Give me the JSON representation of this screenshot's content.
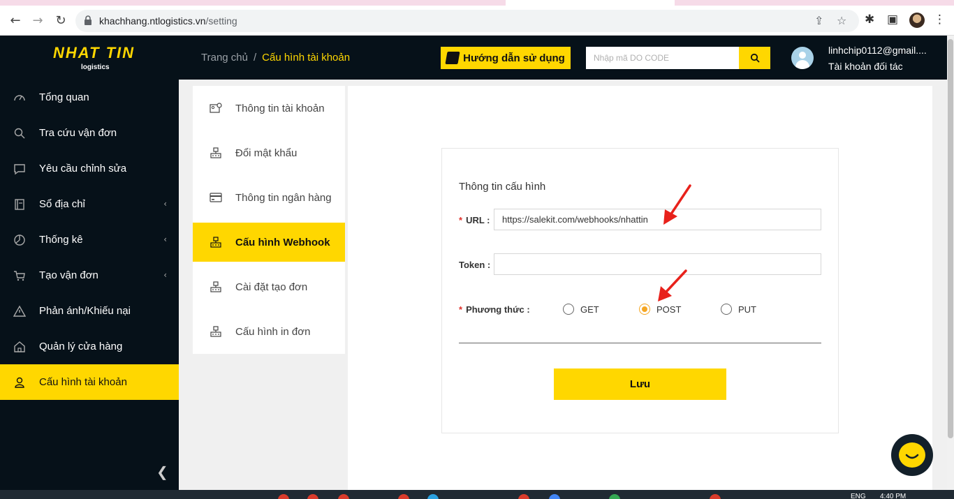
{
  "browser": {
    "url_host": "khachhang.ntlogistics.vn",
    "url_path": "/setting"
  },
  "header": {
    "logo_brand": "NHAT TIN",
    "logo_sub": "logistics",
    "breadcrumb_home": "Trang chủ",
    "breadcrumb_sep": "/",
    "breadcrumb_current": "Cấu hình tài khoản",
    "guide_label": "Hướng dẫn sử dụng",
    "search_placeholder": "Nhập mã DO CODE",
    "user_email": "linhchip0112@gmail....",
    "user_role": "Tài khoản đối tác"
  },
  "sidebar": {
    "items": [
      {
        "label": "Tổng quan"
      },
      {
        "label": "Tra cứu vận đơn"
      },
      {
        "label": "Yêu cầu chỉnh sửa"
      },
      {
        "label": "Sổ địa chỉ"
      },
      {
        "label": "Thống kê"
      },
      {
        "label": "Tạo vận đơn"
      },
      {
        "label": "Phản ánh/Khiếu nại"
      },
      {
        "label": "Quản lý cửa hàng"
      },
      {
        "label": "Cấu hình tài khoản"
      }
    ],
    "active_index": 8
  },
  "submenu": {
    "items": [
      {
        "label": "Thông tin tài khoản"
      },
      {
        "label": "Đổi mật khẩu"
      },
      {
        "label": "Thông tin ngân hàng"
      },
      {
        "label": "Cấu hình Webhook"
      },
      {
        "label": "Cài đặt tạo đơn"
      },
      {
        "label": "Cấu hình in đơn"
      }
    ],
    "active_index": 3
  },
  "form": {
    "title": "Thông tin cấu hình",
    "url_label": "URL :",
    "url_value": "https://salekit.com/webhooks/nhattin",
    "token_label": "Token :",
    "token_value": "",
    "method_label": "Phương thức :",
    "methods": [
      "GET",
      "POST",
      "PUT"
    ],
    "selected_method": "POST",
    "save_label": "Lưu"
  },
  "taskbar": {
    "lang": "ENG",
    "time": "4:40 PM"
  },
  "colors": {
    "accent": "#ffd700",
    "dark": "#061119",
    "radio_selected": "#f5a623",
    "required": "#e0312b",
    "annotation_arrow": "#e8211b"
  }
}
